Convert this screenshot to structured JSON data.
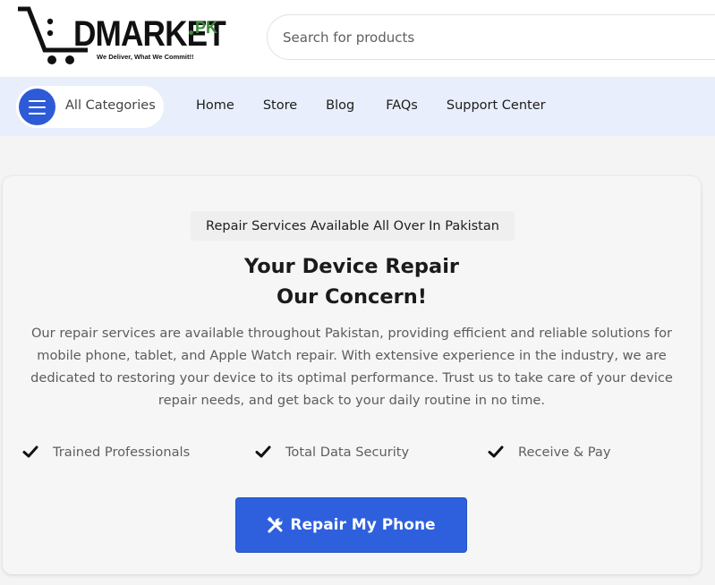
{
  "header": {
    "logo": {
      "wordmark": "DMARKET",
      "suffix": "PK",
      "tagline": "We Deliver, What We Commit!!",
      "brand_color": "#3c8a3a",
      "icon": "shopping-cart-icon"
    },
    "search": {
      "placeholder": "Search for products",
      "value": ""
    }
  },
  "nav": {
    "categories_label": "All Categories",
    "categories_icon": "hamburger-menu-icon",
    "accent_color": "#2d5bd7",
    "links": [
      {
        "label": "Home"
      },
      {
        "label": "Store"
      },
      {
        "label": "Blog"
      },
      {
        "label": "FAQs"
      },
      {
        "label": "Support Center"
      }
    ]
  },
  "hero": {
    "badge": "Repair Services Available All Over In Pakistan",
    "title_line1": "Your Device Repair",
    "title_line2": "Our Concern!",
    "description": "Our repair services are available throughout Pakistan, providing efficient and reliable solutions for mobile phone, tablet, and Apple Watch repair. With extensive experience in the industry, we are dedicated to restoring your device to its optimal performance. Trust us to take care of your device repair needs, and get back to your daily routine in no time.",
    "features": [
      {
        "icon": "check-icon",
        "label": "Trained Professionals"
      },
      {
        "icon": "check-icon",
        "label": "Total Data Security"
      },
      {
        "icon": "check-icon",
        "label": "Receive & Pay"
      }
    ],
    "cta": {
      "label": "Repair My Phone",
      "icon": "tools-icon",
      "color": "#2e60de"
    }
  }
}
